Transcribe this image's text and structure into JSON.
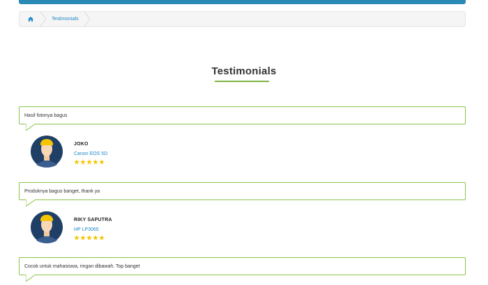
{
  "colors": {
    "accent_green": "#8bc34a",
    "link_blue": "#1e88c7",
    "star_gold": "#f5c400",
    "topbar_blue": "#2b8ab5"
  },
  "breadcrumb": {
    "home_icon": "home-icon",
    "items": [
      {
        "label": "Testimonials"
      }
    ]
  },
  "section": {
    "title": "Testimonials"
  },
  "testimonials": [
    {
      "text": "Hasil fotonya bagus",
      "name": "JOKO",
      "product": "Canon EOS 5D",
      "rating": 5
    },
    {
      "text": "Produknya bagus banget, thank ya",
      "name": "RIKY SAPUTRA",
      "product": "HP LP3065",
      "rating": 5
    },
    {
      "text": "Cocok untuk mahasiswa, ringan dibawah. Top banget"
    }
  ]
}
